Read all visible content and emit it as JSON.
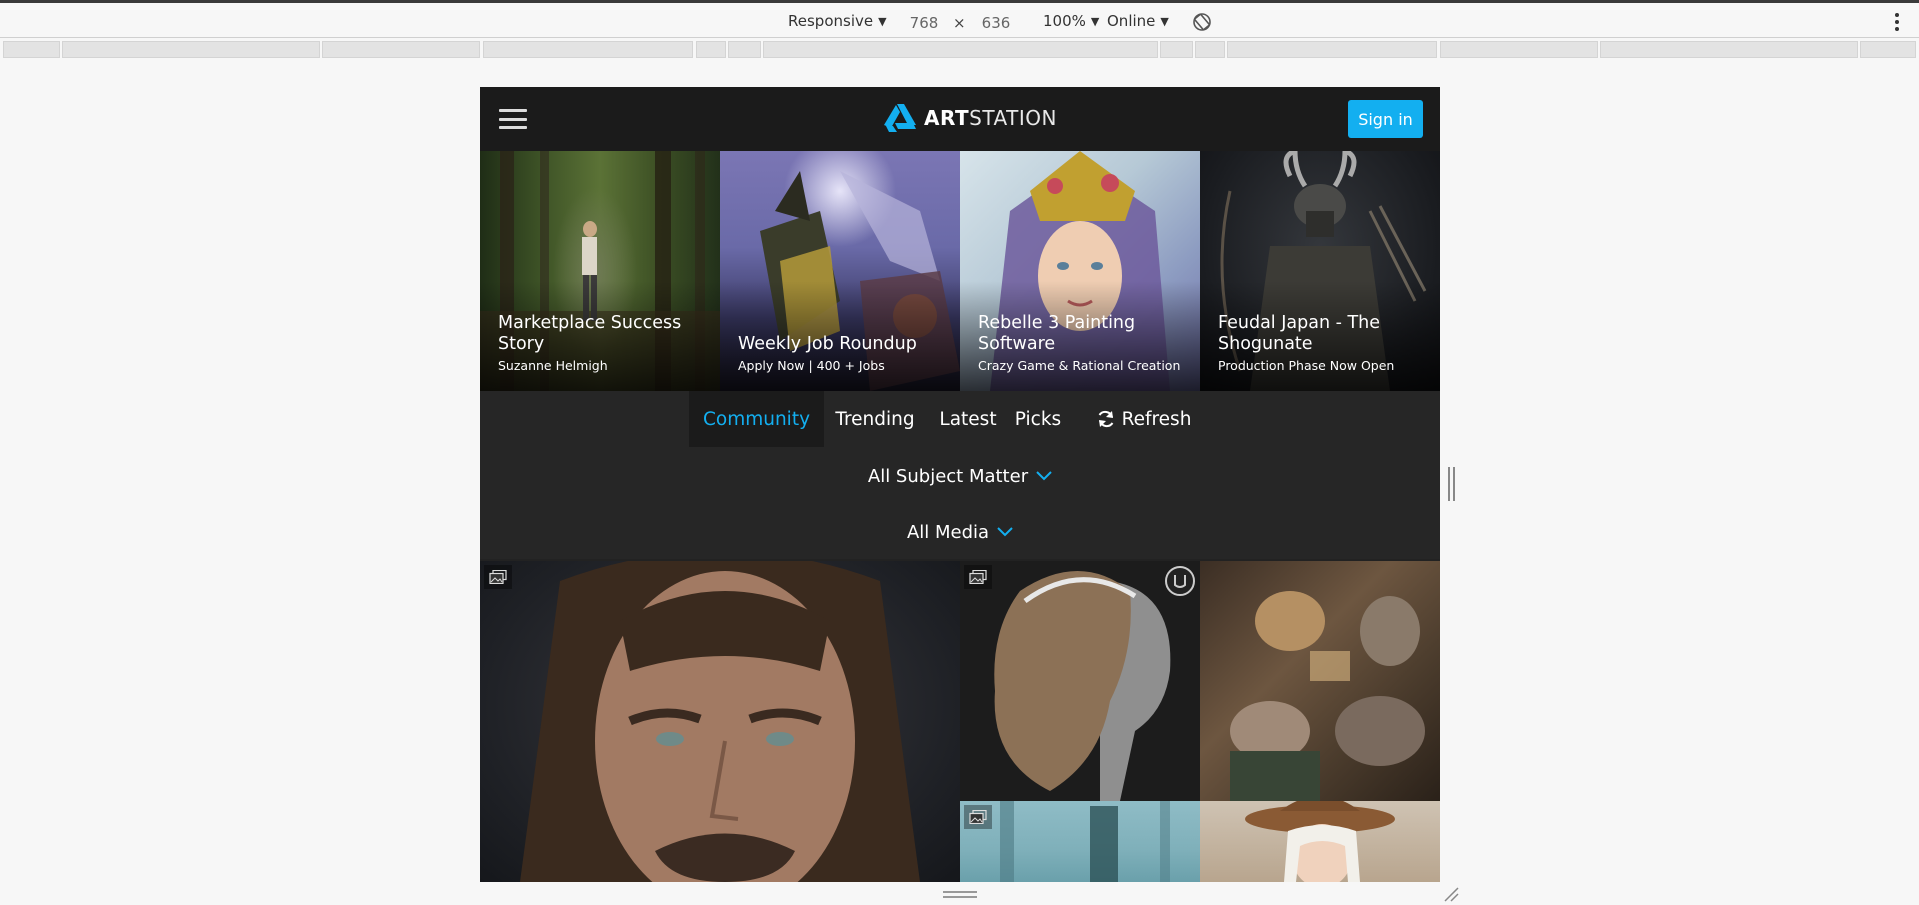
{
  "devtools": {
    "device": "Responsive",
    "width": "768",
    "height": "636",
    "times": "×",
    "zoom": "100%",
    "network": "Online"
  },
  "header": {
    "logo_bold": "ART",
    "logo_regular": "STATION",
    "signin_label": "Sign in",
    "accent_color": "#13aff0"
  },
  "hero": [
    {
      "title": "Marketplace Success Story",
      "subtitle": "Suzanne Helmigh"
    },
    {
      "title": "Weekly Job Roundup",
      "subtitle": "Apply Now | 400 + Jobs"
    },
    {
      "title": "Rebelle 3 Painting Software",
      "subtitle": "Crazy Game & Rational Creation"
    },
    {
      "title": "Feudal Japan - The Shogunate",
      "subtitle": "Production Phase Now Open"
    }
  ],
  "tabs": [
    {
      "label": "Community",
      "active": true
    },
    {
      "label": "Trending",
      "active": false
    },
    {
      "label": "Latest",
      "active": false
    },
    {
      "label": "Picks",
      "active": false
    },
    {
      "label": "Refresh",
      "active": false,
      "icon": "refresh-icon"
    }
  ],
  "filters": {
    "subject": "All Subject Matter",
    "media": "All Media"
  }
}
